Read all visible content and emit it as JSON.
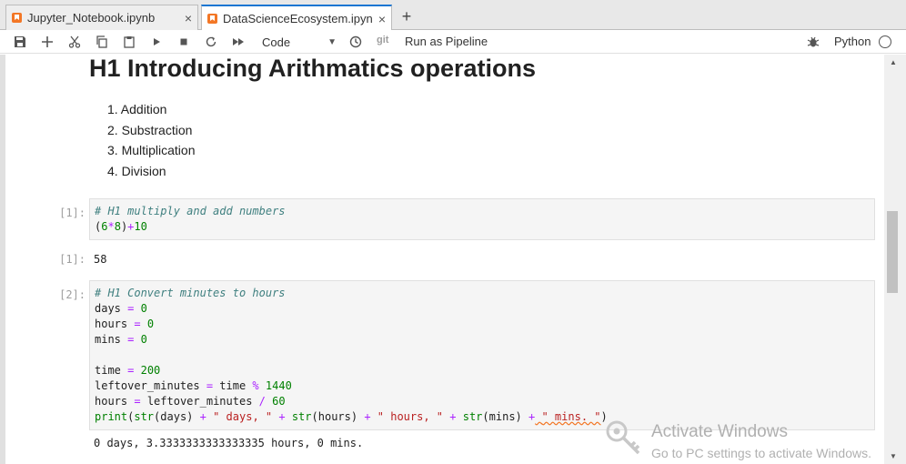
{
  "tabs": [
    {
      "label": "Jupyter_Notebook.ipynb",
      "close": "×"
    },
    {
      "label": "DataScienceEcosystem.ipyn",
      "close": "×"
    }
  ],
  "tab_add": "+",
  "toolbar": {
    "cell_type": "Code",
    "git_label": "git",
    "run_pipeline": "Run as Pipeline",
    "kernel": "Python"
  },
  "notebook": {
    "heading": "H1 Introducing Arithmatics operations",
    "list_items": [
      "1. Addition",
      "2. Substraction",
      "3. Multiplication",
      "4. Division"
    ],
    "cell1": {
      "prompt": "[1]:",
      "output_prompt": "[1]:",
      "output": "58"
    },
    "cell2": {
      "prompt": "[2]:",
      "output": "0 days, 3.3333333333333335 hours, 0 mins."
    }
  },
  "watermark": {
    "title": "Activate Windows",
    "subtitle": "Go to PC settings to activate Windows."
  },
  "colors": {
    "accent": "#1976d2",
    "notebook_icon": "#f37726",
    "code_comment": "#408080",
    "code_number": "#008000",
    "code_operator": "#aa22ff",
    "code_string": "#ba2121"
  }
}
